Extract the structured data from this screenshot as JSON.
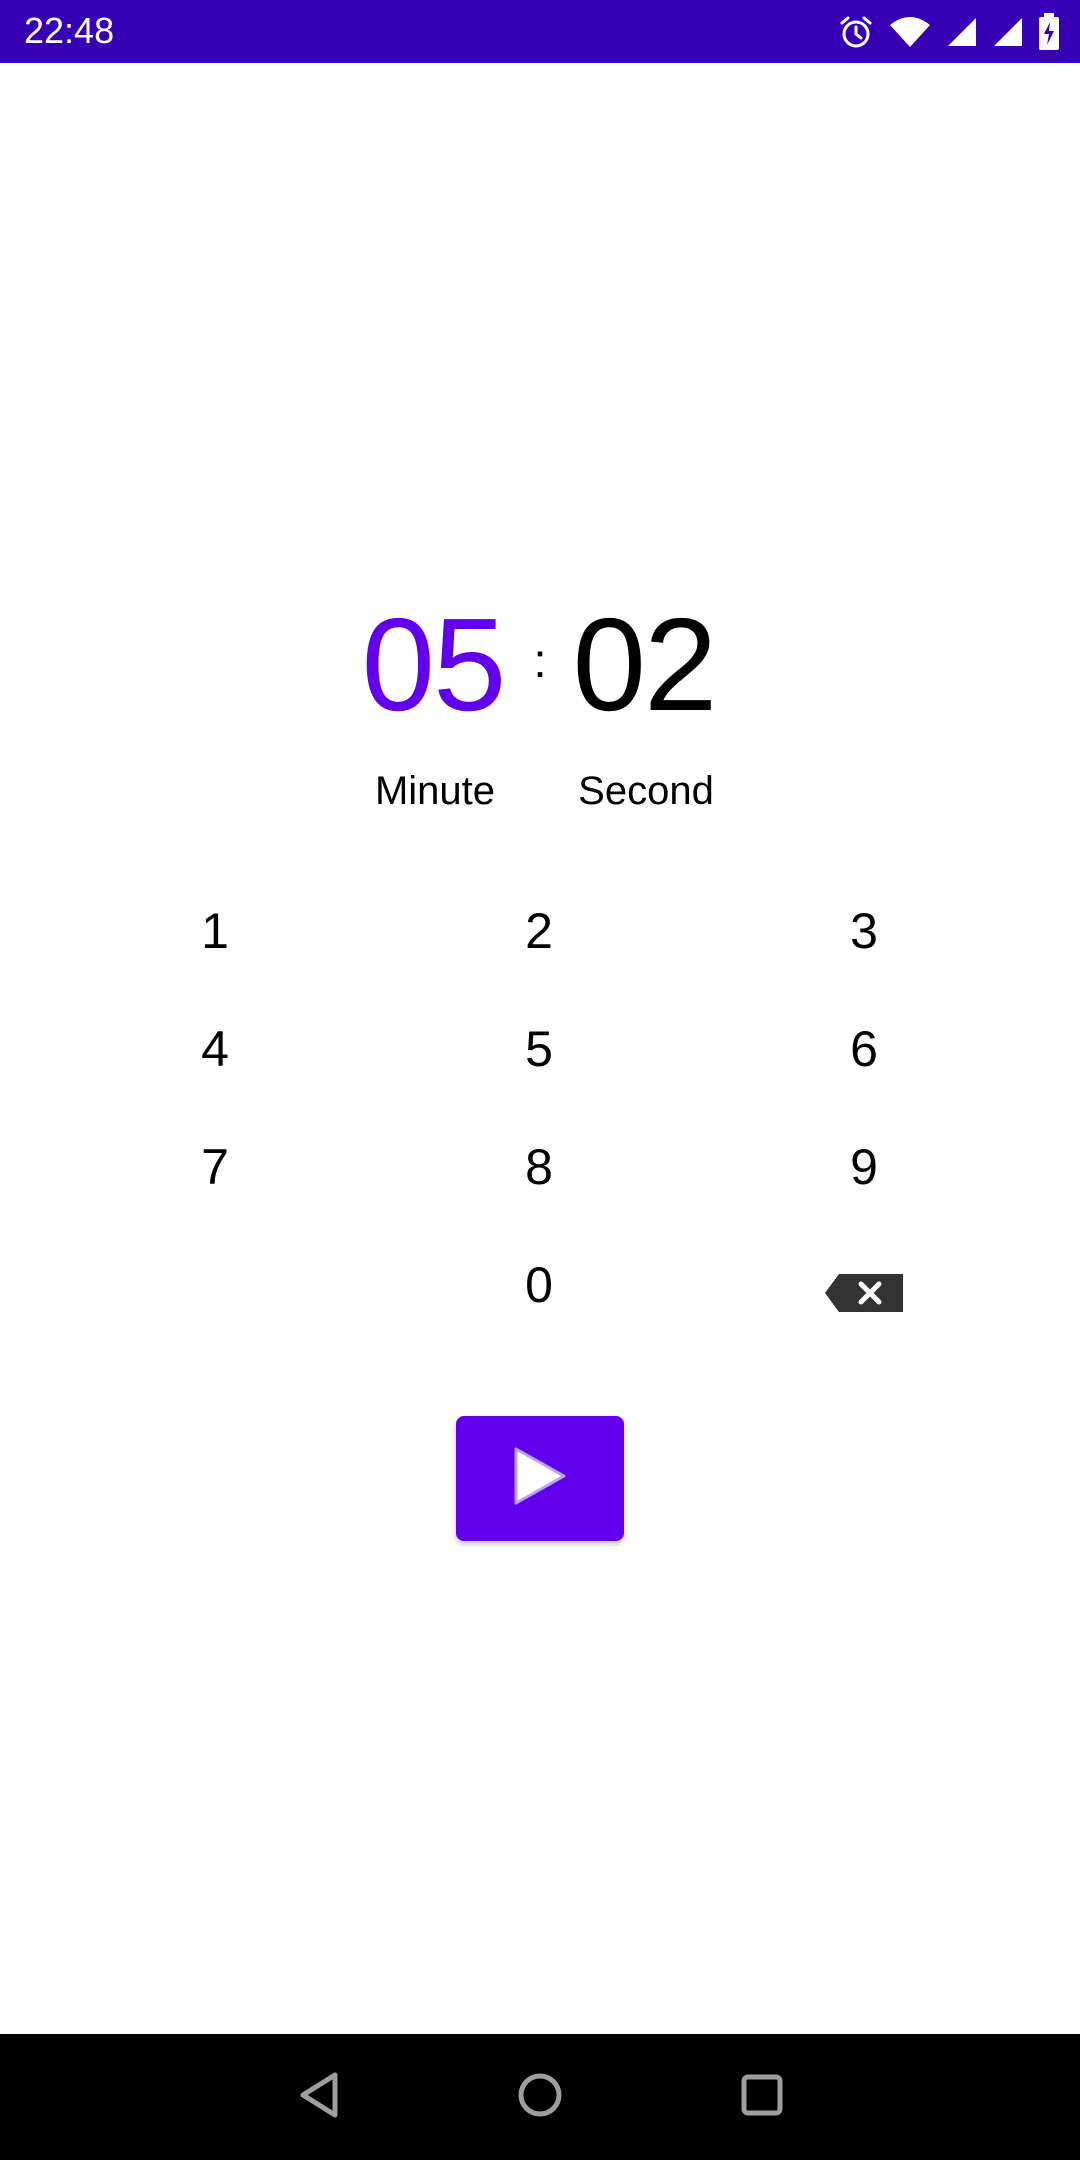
{
  "status_bar": {
    "time": "22:48",
    "icons": [
      "alarm-icon",
      "wifi-icon",
      "signal-icon",
      "signal-icon",
      "battery-charging-icon"
    ],
    "background_color": "#3700b3"
  },
  "timer": {
    "minutes": "05",
    "separator": ":",
    "seconds": "02",
    "minute_label": "Minute",
    "second_label": "Second",
    "active_color": "#6200ee"
  },
  "keypad": {
    "keys": [
      "1",
      "2",
      "3",
      "4",
      "5",
      "6",
      "7",
      "8",
      "9",
      "0"
    ],
    "backspace_icon": "backspace-icon"
  },
  "start_button": {
    "icon": "play-icon",
    "color": "#6200ee"
  },
  "nav_bar": {
    "icons": [
      "back-icon",
      "home-icon",
      "recents-icon"
    ]
  }
}
